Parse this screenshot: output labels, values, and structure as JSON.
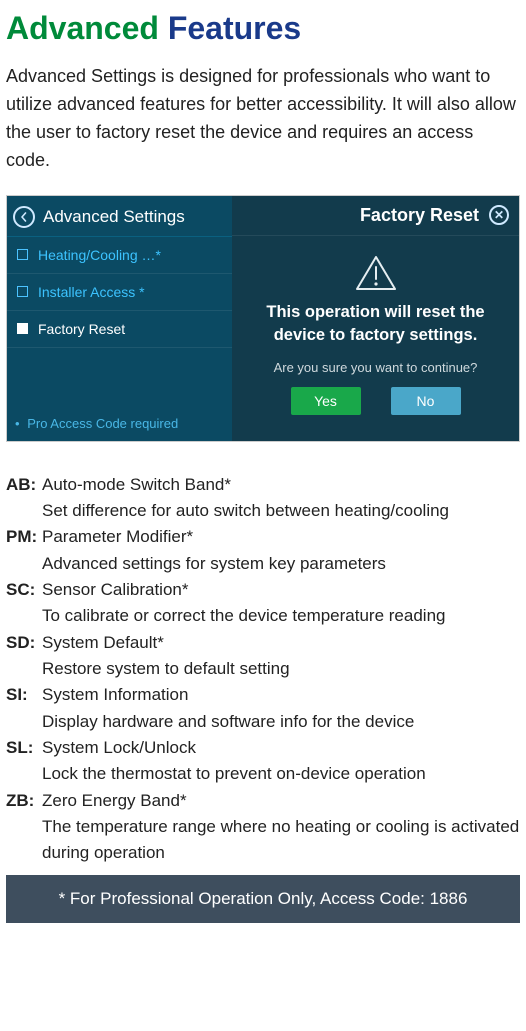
{
  "title": {
    "word1": "Advanced",
    "word2": "Features"
  },
  "intro": "Advanced Settings is designed for professionals who want to utilize advanced features for better accessibility. It will also allow the user to factory reset the device and requires an access code.",
  "device": {
    "left_header": "Advanced Settings",
    "menu": {
      "item0": "Heating/Cooling …*",
      "item1": "Installer Access *",
      "item2": "Factory Reset"
    },
    "left_footer_bullet": "•",
    "left_footer": "Pro Access Code required",
    "right_header": "Factory Reset",
    "warning": "This operation will reset the device to factory settings.",
    "confirm": "Are you sure you want to continue?",
    "yes": "Yes",
    "no": "No"
  },
  "defs": {
    "d0": {
      "code": "AB:",
      "title": "Auto-mode Switch Band*",
      "desc": "Set difference for auto switch between heating/cooling"
    },
    "d1": {
      "code": "PM:",
      "title": "Parameter Modifier*",
      "desc": "Advanced settings for system key parameters"
    },
    "d2": {
      "code": "SC:",
      "title": "Sensor Calibration*",
      "desc": "To calibrate or correct the device temperature reading"
    },
    "d3": {
      "code": "SD:",
      "title": "System Default*",
      "desc": "Restore system to default setting"
    },
    "d4": {
      "code": "SI:",
      "title": "System Information",
      "desc": "Display hardware and software info for the device"
    },
    "d5": {
      "code": "SL:",
      "title": "System Lock/Unlock",
      "desc": "Lock the thermostat to prevent on-device operation"
    },
    "d6": {
      "code": "ZB:",
      "title": "Zero Energy Band*",
      "desc": "The temperature range where no heating or cooling is activated during operation"
    }
  },
  "footnote": "* For Professional Operation Only, Access Code: 1886"
}
